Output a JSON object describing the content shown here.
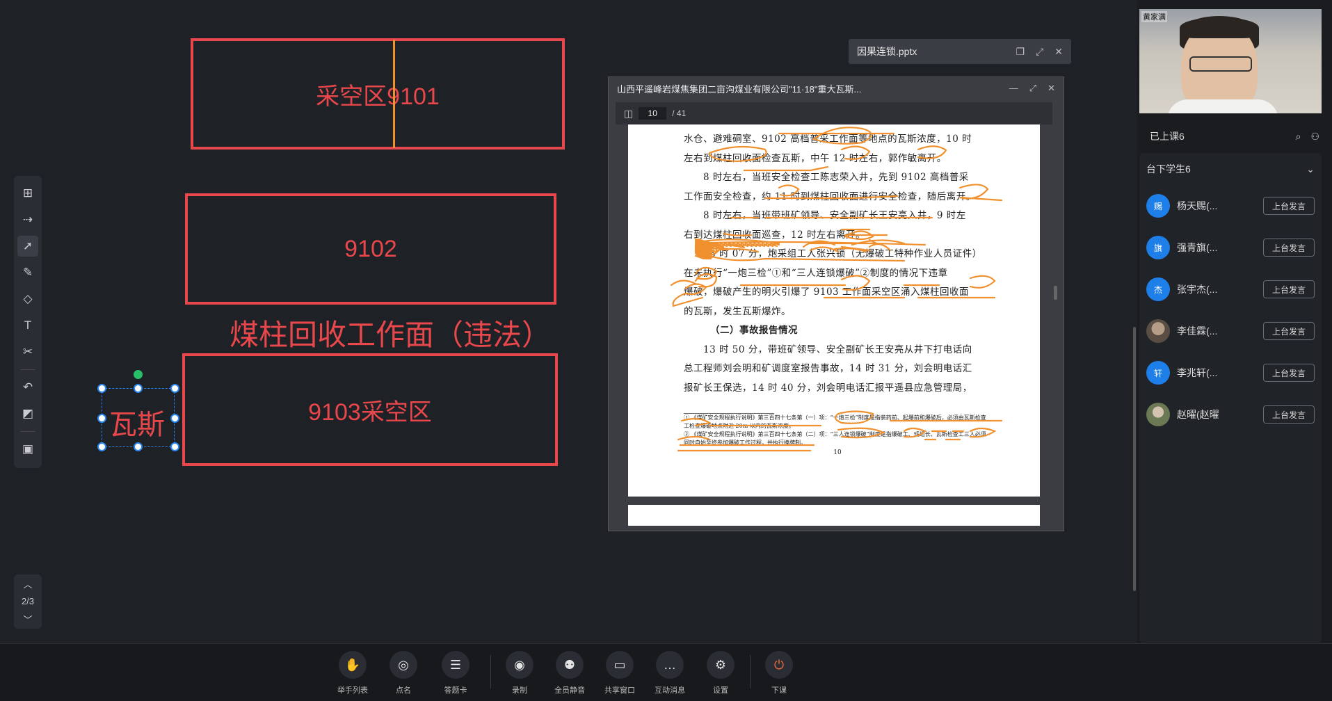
{
  "whiteboard": {
    "box1_label": "采空区9101",
    "box2_label": "9102",
    "heading": "煤柱回收工作面（违法）",
    "box3_label": "9103采空区",
    "selected_text": "瓦斯"
  },
  "toolbar": {
    "tools": [
      "insert-icon",
      "laser-icon",
      "select-icon",
      "pen-icon",
      "shapes-icon",
      "text-icon",
      "scissors-icon",
      "undo-icon",
      "eraser-icon",
      "toolbox-icon"
    ]
  },
  "page_nav": {
    "page": "2/3"
  },
  "file_tab": {
    "title": "因果连锁.pptx"
  },
  "pdf": {
    "title": "山西平遥峰岩煤焦集团二亩沟煤业有限公司\"11·18\"重大瓦斯...",
    "current_page": "10",
    "total_pages": "/ 41",
    "paragraphs": [
      "水仓、避难硐室、9102 高档普采工作面等地点的瓦斯浓度，10 时",
      "左右到煤柱回收面检查瓦斯，中午 12 时左右，郭作敏离开。",
      "　　8 时左右，当班安全检查工陈志荣入井，先到 9102 高档普采",
      "工作面安全检查，约 11 时到煤柱回收面进行安全检查，随后离开。",
      "　　8 时左右，当班带班矿领导、安全副矿长王安亮入井，9 时左",
      "右到达煤柱回收面巡查，12 时左右离开。",
      "　　13 时 07 分，炮采组工人张兴锁（无爆破工特种作业人员证件）",
      "在未执行“一炮三检”①和“三人连锁爆破”②制度的情况下违章",
      "爆破，爆破产生的明火引爆了 9103 工作面采空区涌入煤柱回收面",
      "的瓦斯，发生瓦斯爆炸。"
    ],
    "section_heading": "（二）事故报告情况",
    "paragraphs2": [
      "　　13 时 50 分，带班矿领导、安全副矿长王安亮从井下打电话向",
      "总工程师刘会明和矿调度室报告事故，14 时 31 分，刘会明电话汇",
      "报矿长王保选，14 时 40 分，刘会明电话汇报平遥县应急管理局，"
    ],
    "footnotes": [
      "① 《煤矿安全规程执行说明》第三百四十七条第（一）项：“一炮三检”制度是指装药前、起爆前和爆破后，必须由瓦斯检查工检查爆破地点附近 20m 以内的瓦斯浓度。",
      "② 《煤矿安全规程执行说明》第三百四十七条第（二）项：“三人连锁爆破”制度是指爆破工、班组长、瓦斯检查工三人必须同时自始至终参加爆破工作过程，并执行换牌制。"
    ],
    "page_number": "10"
  },
  "teacher_video": {
    "name": "黄家满"
  },
  "class": {
    "on_stage": "已上课6",
    "off_stage": "台下学生6",
    "students": [
      {
        "avatar": "赐",
        "name": "杨天赐(...",
        "button": "上台发言",
        "photo": false
      },
      {
        "avatar": "旗",
        "name": "强青旗(...",
        "button": "上台发言",
        "photo": false
      },
      {
        "avatar": "杰",
        "name": "张宇杰(...",
        "button": "上台发言",
        "photo": false
      },
      {
        "avatar": "",
        "name": "李佳霖(...",
        "button": "上台发言",
        "photo": true
      },
      {
        "avatar": "轩",
        "name": "李兆轩(...",
        "button": "上台发言",
        "photo": false
      },
      {
        "avatar": "",
        "name": "赵曜(赵曜",
        "button": "上台发言",
        "photo": true
      }
    ]
  },
  "bottom_bar": {
    "buttons": [
      {
        "icon": "hand-icon",
        "label": "举手列表"
      },
      {
        "icon": "rollcall-icon",
        "label": "点名"
      },
      {
        "icon": "answer-card-icon",
        "label": "答题卡"
      },
      {
        "icon": "record-icon",
        "label": "录制"
      },
      {
        "icon": "mute-all-icon",
        "label": "全员静音"
      },
      {
        "icon": "share-window-icon",
        "label": "共享窗口"
      },
      {
        "icon": "chat-icon",
        "label": "互动消息"
      },
      {
        "icon": "settings-icon",
        "label": "设置"
      },
      {
        "icon": "power-icon",
        "label": "下课"
      }
    ]
  },
  "colors": {
    "annotation_red": "#e8474b",
    "annotation_orange": "#f0902e",
    "accent_blue": "#1f7fe8"
  }
}
